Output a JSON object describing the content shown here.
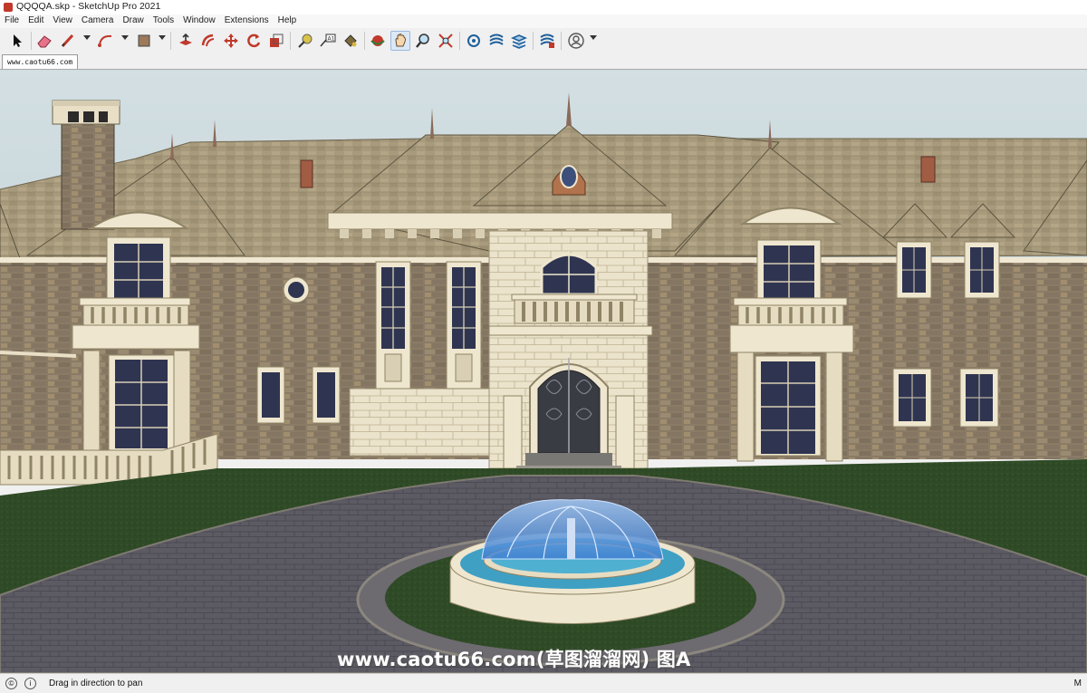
{
  "window": {
    "title": "QQQQA.skp - SketchUp Pro 2021"
  },
  "menu": [
    "File",
    "Edit",
    "View",
    "Camera",
    "Draw",
    "Tools",
    "Window",
    "Extensions",
    "Help"
  ],
  "toolbar": {
    "tools": [
      {
        "name": "select-icon"
      },
      {
        "name": "eraser-icon"
      },
      {
        "name": "line-icon"
      },
      {
        "name": "arc-icon"
      },
      {
        "name": "rectangle-icon"
      },
      {
        "name": "push-pull-icon"
      },
      {
        "name": "offset-icon"
      },
      {
        "name": "move-icon"
      },
      {
        "name": "rotate-icon"
      },
      {
        "name": "scale-icon"
      },
      {
        "name": "tape-measure-icon"
      },
      {
        "name": "text-icon"
      },
      {
        "name": "paint-bucket-icon"
      },
      {
        "name": "orbit-icon"
      },
      {
        "name": "pan-icon",
        "active": true
      },
      {
        "name": "zoom-icon"
      },
      {
        "name": "zoom-extents-icon"
      },
      {
        "name": "warehouse-icon"
      },
      {
        "name": "extension-warehouse-icon"
      },
      {
        "name": "layout-icon"
      },
      {
        "name": "extension-manager-icon"
      },
      {
        "name": "user-account-icon"
      }
    ]
  },
  "tab": {
    "label": "www.caotu66.com"
  },
  "status": {
    "message": "Drag in direction to pan",
    "measurements_label": "M"
  },
  "watermark": {
    "text": "www.caotu66.com(草图溜溜网) 图A"
  },
  "colors": {
    "sky": "#cddbdf",
    "roof": "#a89a7c",
    "stone": "#8a7a66",
    "trim": "#efe6cf",
    "grass": "#2f4a25",
    "pavement": "#5a5860",
    "water": "#4fa3c8"
  }
}
